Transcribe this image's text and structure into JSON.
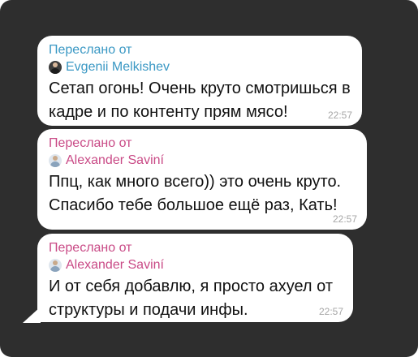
{
  "colors": {
    "background": "#2e2e2e",
    "bubble": "#ffffff",
    "forward_blue": "#3a98c4",
    "forward_pink": "#c94a86",
    "timestamp": "#a6a6a6"
  },
  "messages": [
    {
      "forwarded_label": "Переслано от",
      "sender": "Evgenii Melkishev",
      "avatar_icon": "user-avatar-icon",
      "text": "Сетап огонь! Очень круто смотришься в кадре и по контенту прям мясо!",
      "time": "22:57"
    },
    {
      "forwarded_label": "Переслано от",
      "sender": "Alexander Saviní",
      "avatar_icon": "user-avatar-icon",
      "text": "Ппц, как много всего)) это очень круто. Спасибо тебе большое ещё раз, Кать!",
      "time": "22:57"
    },
    {
      "forwarded_label": "Переслано от",
      "sender": "Alexander Saviní",
      "avatar_icon": "user-avatar-icon",
      "text": "И от себя добавлю, я просто ахуел от структуры и подачи инфы.",
      "time": "22:57"
    }
  ]
}
